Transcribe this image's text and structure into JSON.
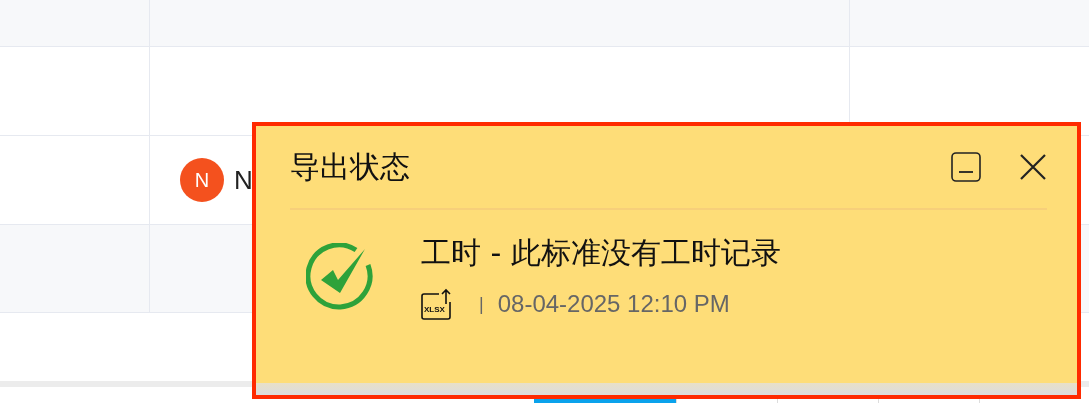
{
  "table": {
    "rows": [
      {
        "avatar": "N",
        "name": "N"
      }
    ]
  },
  "export_panel": {
    "title": "导出状态",
    "items": [
      {
        "kind": "success",
        "title": "工时 - 此标准没有工时记录",
        "file_type": "XLSX",
        "separator": "|",
        "time": "08-04-2025 12:10 PM"
      }
    ]
  }
}
